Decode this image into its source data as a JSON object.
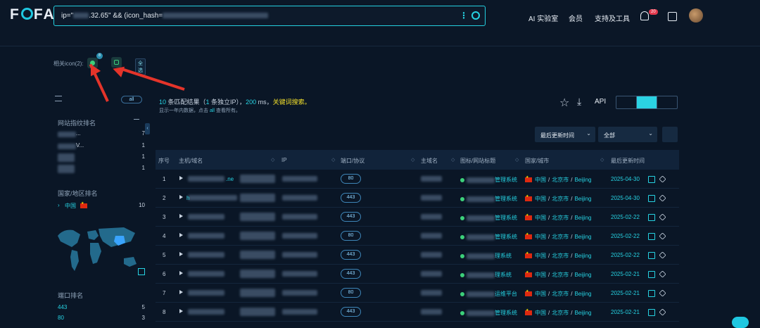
{
  "header": {
    "logo_text_left": "F",
    "logo_text_right": "FA",
    "search_prefix": "ip=\"",
    "search_mid": ".32.65\" && (icon_hash=",
    "nav": [
      "AI 实验室",
      "会员",
      "支持及工具"
    ],
    "notification_count": "20"
  },
  "icon_filter": {
    "label": "相关icon(2):",
    "first_icon_count": "8",
    "select_all": "全选"
  },
  "sidebar": {
    "all_button": "all",
    "site_rank_title": "网站指纹排名",
    "site_rank_counts": [
      "7",
      "1",
      "1",
      "1"
    ],
    "site_rank_labels": [
      "...",
      "V..."
    ],
    "country_rank_title": "国家/地区排名",
    "country": "中国",
    "country_count": "10",
    "port_rank_title": "端口排名",
    "ports": [
      {
        "port": "443",
        "count": "5"
      },
      {
        "port": "80",
        "count": "3"
      }
    ]
  },
  "summary": {
    "count": "10",
    "text_a": " 条匹配结果（",
    "unique": "1",
    "text_b": " 条独立IP），",
    "ms": "200",
    "text_c": " ms，",
    "keyword_search": "关键词搜索。",
    "note_a": "显示一年内数据，点击 ",
    "note_all": "all",
    "note_b": " 查看所有。"
  },
  "toolbar": {
    "api": "API",
    "sort_select": "最后更新时间",
    "scope_select": "全部"
  },
  "table": {
    "headers": [
      "序号",
      "主机/域名",
      "IP",
      "端口/协议",
      "主域名",
      "图标/网站标题",
      "国家/城市",
      "最后更新时间"
    ],
    "rows": [
      {
        "no": "1",
        "host_suffix": ".ne",
        "port": "80",
        "title_suffix": "管理系统",
        "date": "2025-04-30"
      },
      {
        "no": "2",
        "host_suffix": "h",
        "port": "443",
        "title_suffix": "管理系统",
        "date": "2025-04-30"
      },
      {
        "no": "3",
        "host_suffix": "",
        "port": "443",
        "title_suffix": "管理系统",
        "date": "2025-02-22"
      },
      {
        "no": "4",
        "host_suffix": "",
        "port": "80",
        "title_suffix": "管理系统",
        "date": "2025-02-22"
      },
      {
        "no": "5",
        "host_suffix": "",
        "port": "443",
        "title_suffix": "理系统",
        "date": "2025-02-22"
      },
      {
        "no": "6",
        "host_suffix": "",
        "port": "443",
        "title_suffix": "理系统",
        "date": "2025-02-21"
      },
      {
        "no": "7",
        "host_suffix": "",
        "port": "80",
        "title_suffix": "运维平台",
        "date": "2025-02-21"
      },
      {
        "no": "8",
        "host_suffix": "",
        "port": "443",
        "title_suffix": "管理系统",
        "date": "2025-02-21"
      }
    ],
    "country": "中国",
    "city": "北京市",
    "city_en": "Beijing"
  },
  "colors": {
    "accent": "#26d3e3",
    "highlight": "#f3e02b",
    "arrow": "#e4342a"
  }
}
